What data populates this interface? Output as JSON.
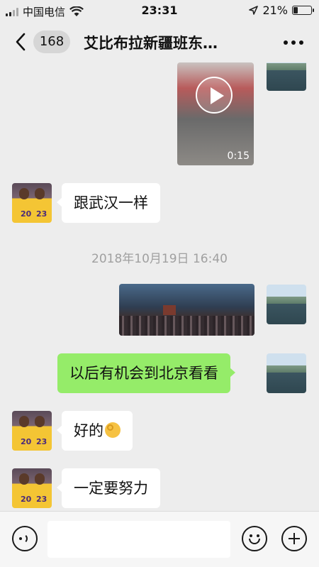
{
  "status_bar": {
    "carrier": "中国电信",
    "time": "23:31",
    "battery": "21%"
  },
  "nav": {
    "unread_count": "168",
    "title": "艾比布拉新疆班东…"
  },
  "messages": {
    "video_duration": "0:15",
    "msg1": "跟武汉一样",
    "timestamp": "2018年10月19日 16:40",
    "msg2": "以后有机会到北京看看",
    "msg3": "好的",
    "msg4": "一定要努力"
  },
  "input": {
    "value": ""
  },
  "colors": {
    "background": "#ededed",
    "sent_bubble": "#95ec69",
    "received_bubble": "#ffffff"
  }
}
